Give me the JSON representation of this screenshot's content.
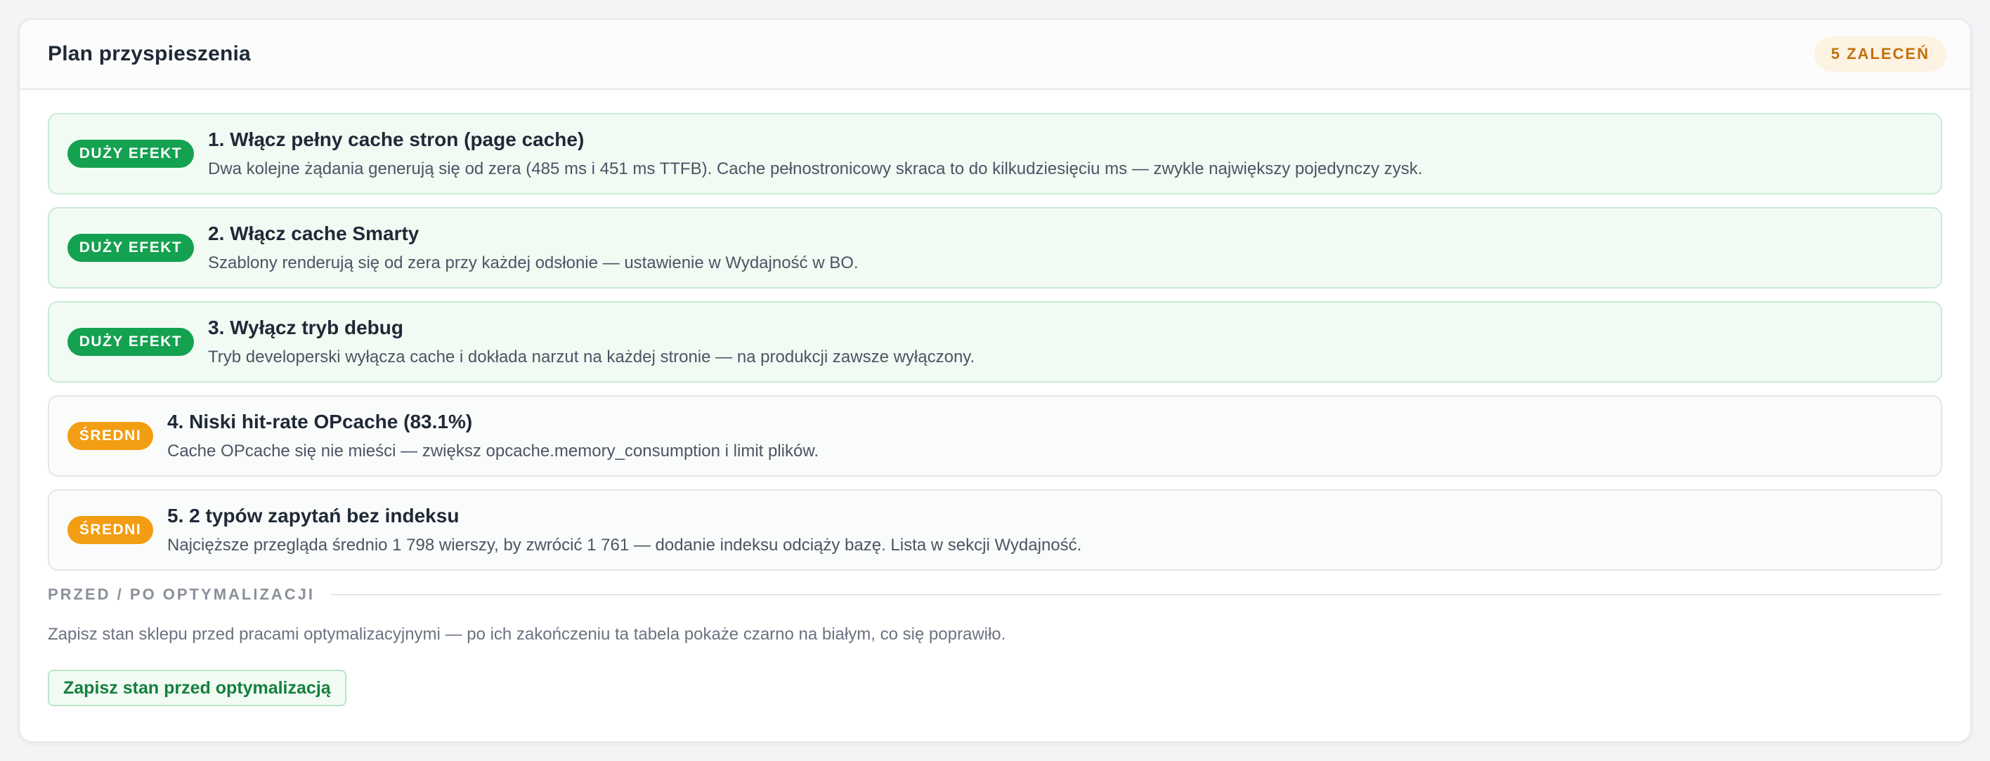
{
  "panel": {
    "title": "Plan przyspieszenia",
    "count_badge": "5 ZALECEŃ"
  },
  "recommendations": [
    {
      "level": "high",
      "badge": "DUŻY EFEKT",
      "title": "1. Włącz pełny cache stron (page cache)",
      "description": "Dwa kolejne żądania generują się od zera (485 ms i 451 ms TTFB). Cache pełnostronicowy skraca to do kilkudziesięciu ms — zwykle największy pojedynczy zysk."
    },
    {
      "level": "high",
      "badge": "DUŻY EFEKT",
      "title": "2. Włącz cache Smarty",
      "description": "Szablony renderują się od zera przy każdej odsłonie — ustawienie w Wydajność w BO."
    },
    {
      "level": "high",
      "badge": "DUŻY EFEKT",
      "title": "3. Wyłącz tryb debug",
      "description": "Tryb developerski wyłącza cache i dokłada narzut na każdej stronie — na produkcji zawsze wyłączony."
    },
    {
      "level": "medium",
      "badge": "ŚREDNI",
      "title": "4. Niski hit-rate OPcache (83.1%)",
      "description": "Cache OPcache się nie mieści — zwiększ opcache.memory_consumption i limit plików."
    },
    {
      "level": "medium",
      "badge": "ŚREDNI",
      "title": "5. 2 typów zapytań bez indeksu",
      "description": "Najcięższe przegląda średnio 1 798 wierszy, by zwrócić 1 761 — dodanie indeksu odciąży bazę. Lista w sekcji Wydajność."
    }
  ],
  "before_after": {
    "label": "PRZED / PO OPTYMALIZACJI",
    "description": "Zapisz stan sklepu przed pracami optymalizacyjnymi — po ich zakończeniu ta tabela pokaże czarno na białym, co się poprawiło.",
    "button_label": "Zapisz stan przed optymalizacją"
  },
  "colors": {
    "high_badge": "#14a150",
    "medium_badge": "#f29d12",
    "count_badge_text": "#c2710c",
    "button_text": "#15803d"
  }
}
